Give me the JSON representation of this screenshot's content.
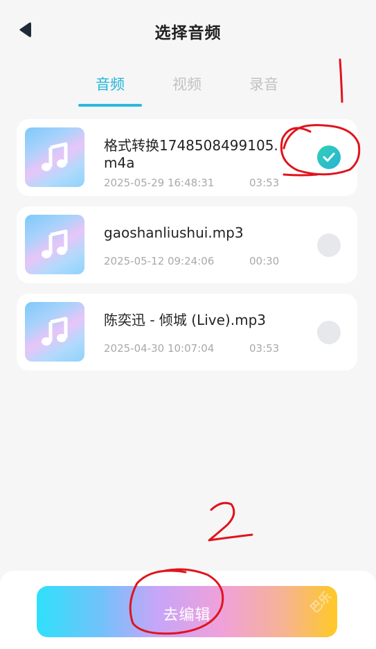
{
  "header": {
    "title": "选择音频",
    "back_icon": "back-arrow-icon"
  },
  "tabs": [
    {
      "label": "音频",
      "active": true
    },
    {
      "label": "视频",
      "active": false
    },
    {
      "label": "录音",
      "active": false
    }
  ],
  "items": [
    {
      "name": "格式转换1748508499105.m4a",
      "date": "2025-05-29 16:48:31",
      "duration": "03:53",
      "selected": true,
      "icon": "music-note-icon"
    },
    {
      "name": "gaoshanliushui.mp3",
      "date": "2025-05-12 09:24:06",
      "duration": "00:30",
      "selected": false,
      "icon": "music-note-icon"
    },
    {
      "name": "陈奕迅 - 倾城 (Live).mp3",
      "date": "2025-04-30 10:07:04",
      "duration": "03:53",
      "selected": false,
      "icon": "music-note-icon"
    }
  ],
  "bottom": {
    "edit_button_label": "去编辑",
    "watermark": "巴乐"
  },
  "annotations": {
    "mark_1": "1",
    "mark_2": "2",
    "color": "#e0141c"
  },
  "colors": {
    "accent": "#25b5d8",
    "check": "#2fc7bf"
  }
}
